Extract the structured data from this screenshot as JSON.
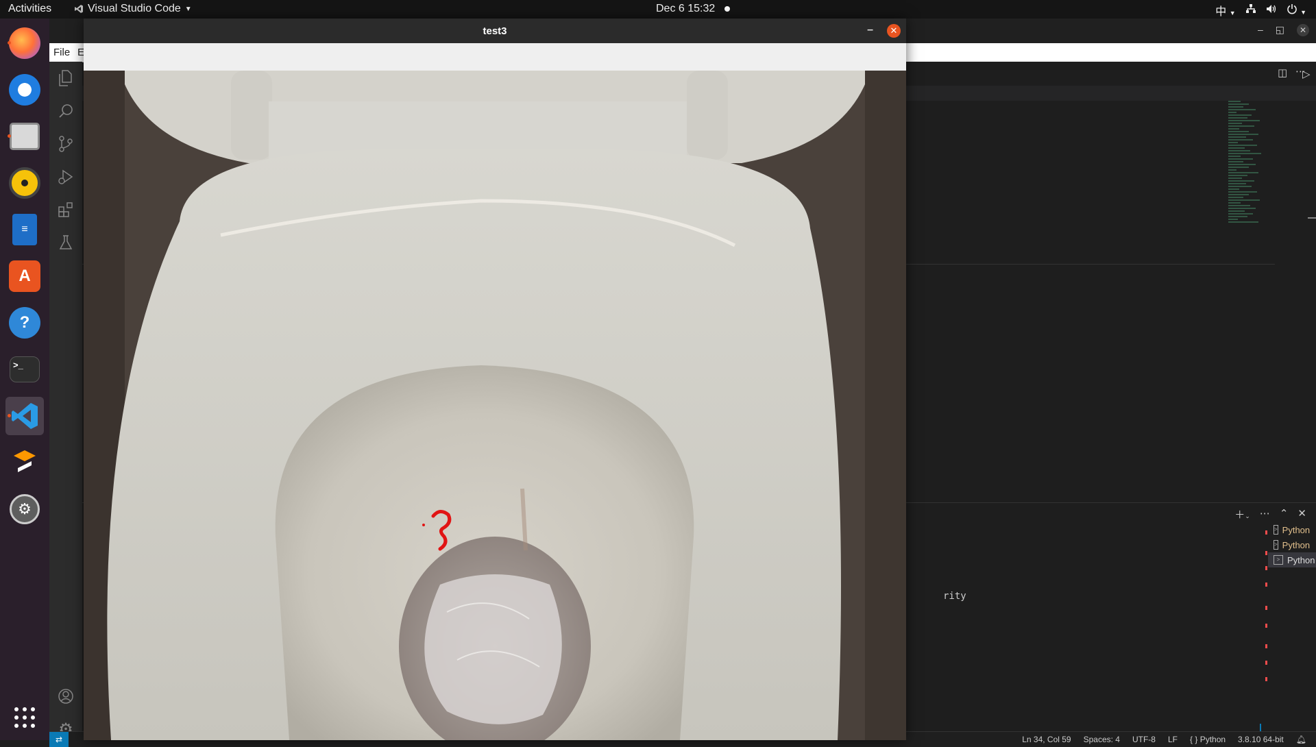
{
  "topbar": {
    "activities": "Activities",
    "app_name": "Visual Studio Code",
    "datetime": "Dec 6  15:32",
    "input_method": "中"
  },
  "dock": {
    "items": [
      "firefox-icon",
      "thunderbird-icon",
      "files-icon",
      "rhythmbox-icon",
      "writer-icon",
      "software-icon",
      "help-icon",
      "terminal-icon",
      "vscode-icon",
      "sublime-icon",
      "settings-icon",
      "show-apps-icon"
    ]
  },
  "vscode": {
    "menu_file": "File",
    "menu_edit": "E",
    "panel_text": "rity",
    "terminals": [
      {
        "label": "Python",
        "warning": true
      },
      {
        "label": "Python",
        "warning": true
      },
      {
        "label": "Python",
        "warning": false
      }
    ],
    "status": {
      "position": "Ln 34, Col 59",
      "spaces": "Spaces: 4",
      "encoding": "UTF-8",
      "eol": "LF",
      "language": "Python",
      "interpreter": "3.8.10 64-bit"
    }
  },
  "viewer": {
    "title": "test3"
  },
  "colors": {
    "ubuntu_orange": "#e95420",
    "vscode_blue": "#0a7ab5",
    "dock_bg": "#2a1f2b",
    "marker_red": "#e11414"
  }
}
